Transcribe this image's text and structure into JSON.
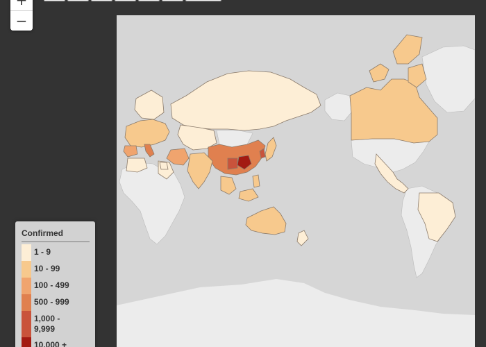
{
  "zoom": {
    "in_label": "+",
    "out_label": "−"
  },
  "legend": {
    "title": "Confirmed",
    "items": [
      {
        "label": "1 - 9",
        "color": "#fdeed6"
      },
      {
        "label": "10 - 99",
        "color": "#f7c98d"
      },
      {
        "label": "100 - 499",
        "color": "#f0a46e"
      },
      {
        "label": "500 - 999",
        "color": "#e0804f"
      },
      {
        "label": "1,000 - 9,999",
        "color": "#c9533b"
      },
      {
        "label": "10,000 +",
        "color": "#a31a12"
      }
    ]
  },
  "map": {
    "ocean_color": "#d6d6d6",
    "no_data_color": "#ececec",
    "countries": [
      {
        "name": "russia",
        "level": 1
      },
      {
        "name": "kazakhstan",
        "level": 1
      },
      {
        "name": "mongolia",
        "level": 0
      },
      {
        "name": "china",
        "level": 4
      },
      {
        "name": "hubei",
        "level": 5
      },
      {
        "name": "japan",
        "level": 2
      },
      {
        "name": "south-korea",
        "level": 2
      },
      {
        "name": "india",
        "level": 2
      },
      {
        "name": "iran",
        "level": 2
      },
      {
        "name": "middle-east",
        "level": 1
      },
      {
        "name": "southeast-asia",
        "level": 2
      },
      {
        "name": "australia",
        "level": 2
      },
      {
        "name": "new-zealand",
        "level": 1
      },
      {
        "name": "canada",
        "level": 2
      },
      {
        "name": "usa",
        "level": 0
      },
      {
        "name": "mexico",
        "level": 1
      },
      {
        "name": "brazil",
        "level": 1
      },
      {
        "name": "europe",
        "level": 2
      },
      {
        "name": "scandinavia",
        "level": 1
      },
      {
        "name": "italy",
        "level": 3
      },
      {
        "name": "north-africa",
        "level": 1
      },
      {
        "name": "greenland",
        "level": 0
      }
    ]
  }
}
